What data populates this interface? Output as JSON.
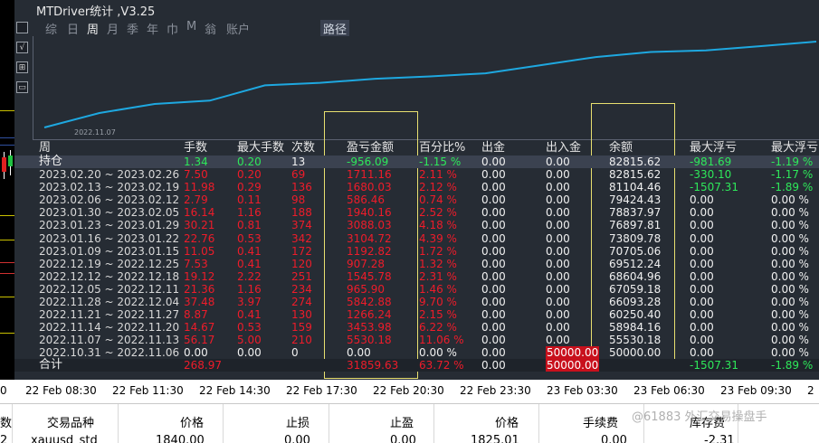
{
  "window": {
    "title": "MTDriver统计 ,V3.25",
    "tabs": [
      "综",
      "日",
      "周",
      "月",
      "季",
      "年",
      "巾",
      "M",
      "翁",
      "账户"
    ],
    "active_tab": "周",
    "path_button": "路径",
    "side_icons": [
      "square-icon",
      "chart-icon",
      "zoom-icon",
      "window-icon"
    ]
  },
  "curve": {
    "start_date": "2022.11.07",
    "line_color": "#1ea8e0",
    "balance_points": [
      50000.0,
      55530.18,
      58984.16,
      60250.4,
      66093.28,
      67059.18,
      68604.96,
      69512.24,
      70705.06,
      73809.78,
      76897.81,
      78837.97,
      79424.43,
      81104.46,
      82815.62
    ]
  },
  "table": {
    "headers": [
      "周",
      "手数",
      "最大手数",
      "次数",
      "盈亏金额",
      "百分比%",
      "出金",
      "出入金",
      "余额",
      "最大浮亏",
      "最大浮亏"
    ],
    "holding": {
      "label": "持仓",
      "lots": "1.34",
      "max_lots": "0.20",
      "count": "13",
      "pnl": "-956.09",
      "pct": "-1.15 %",
      "withdraw": "0.00",
      "inout": "0.00",
      "balance": "82815.62",
      "max_dd": "-981.69",
      "max_dd_pct": "-1.19 %"
    },
    "rows": [
      {
        "week": "2023.02.20 ~ 2023.02.26",
        "lots": "7.50",
        "max_lots": "0.20",
        "count": "69",
        "pnl": "1711.16",
        "pct": "2.11 %",
        "withdraw": "0.00",
        "inout": "0.00",
        "balance": "82815.62",
        "max_dd": "-330.10",
        "max_dd_pct": "-1.17 %"
      },
      {
        "week": "2023.02.13 ~ 2023.02.19",
        "lots": "11.98",
        "max_lots": "0.29",
        "count": "136",
        "pnl": "1680.03",
        "pct": "2.12 %",
        "withdraw": "0.00",
        "inout": "0.00",
        "balance": "81104.46",
        "max_dd": "-1507.31",
        "max_dd_pct": "-1.89 %"
      },
      {
        "week": "2023.02.06 ~ 2023.02.12",
        "lots": "2.79",
        "max_lots": "0.11",
        "count": "98",
        "pnl": "586.46",
        "pct": "0.74 %",
        "withdraw": "0.00",
        "inout": "0.00",
        "balance": "79424.43",
        "max_dd": "0.00",
        "max_dd_pct": "0.00 %"
      },
      {
        "week": "2023.01.30 ~ 2023.02.05",
        "lots": "16.14",
        "max_lots": "1.16",
        "count": "188",
        "pnl": "1940.16",
        "pct": "2.52 %",
        "withdraw": "0.00",
        "inout": "0.00",
        "balance": "78837.97",
        "max_dd": "0.00",
        "max_dd_pct": "0.00 %"
      },
      {
        "week": "2023.01.23 ~ 2023.01.29",
        "lots": "30.21",
        "max_lots": "0.81",
        "count": "374",
        "pnl": "3088.03",
        "pct": "4.18 %",
        "withdraw": "0.00",
        "inout": "0.00",
        "balance": "76897.81",
        "max_dd": "0.00",
        "max_dd_pct": "0.00 %"
      },
      {
        "week": "2023.01.16 ~ 2023.01.22",
        "lots": "22.76",
        "max_lots": "0.53",
        "count": "342",
        "pnl": "3104.72",
        "pct": "4.39 %",
        "withdraw": "0.00",
        "inout": "0.00",
        "balance": "73809.78",
        "max_dd": "0.00",
        "max_dd_pct": "0.00 %"
      },
      {
        "week": "2023.01.09 ~ 2023.01.15",
        "lots": "11.05",
        "max_lots": "0.41",
        "count": "172",
        "pnl": "1192.82",
        "pct": "1.72 %",
        "withdraw": "0.00",
        "inout": "0.00",
        "balance": "70705.06",
        "max_dd": "0.00",
        "max_dd_pct": "0.00 %"
      },
      {
        "week": "2022.12.19 ~ 2022.12.25",
        "lots": "7.53",
        "max_lots": "0.41",
        "count": "120",
        "pnl": "907.28",
        "pct": "1.32 %",
        "withdraw": "0.00",
        "inout": "0.00",
        "balance": "69512.24",
        "max_dd": "0.00",
        "max_dd_pct": "0.00 %"
      },
      {
        "week": "2022.12.12 ~ 2022.12.18",
        "lots": "19.12",
        "max_lots": "2.22",
        "count": "251",
        "pnl": "1545.78",
        "pct": "2.31 %",
        "withdraw": "0.00",
        "inout": "0.00",
        "balance": "68604.96",
        "max_dd": "0.00",
        "max_dd_pct": "0.00 %"
      },
      {
        "week": "2022.12.05 ~ 2022.12.11",
        "lots": "21.36",
        "max_lots": "1.16",
        "count": "234",
        "pnl": "965.90",
        "pct": "1.46 %",
        "withdraw": "0.00",
        "inout": "0.00",
        "balance": "67059.18",
        "max_dd": "0.00",
        "max_dd_pct": "0.00 %"
      },
      {
        "week": "2022.11.28 ~ 2022.12.04",
        "lots": "37.48",
        "max_lots": "3.97",
        "count": "274",
        "pnl": "5842.88",
        "pct": "9.70 %",
        "withdraw": "0.00",
        "inout": "0.00",
        "balance": "66093.28",
        "max_dd": "0.00",
        "max_dd_pct": "0.00 %"
      },
      {
        "week": "2022.11.21 ~ 2022.11.27",
        "lots": "8.87",
        "max_lots": "0.41",
        "count": "130",
        "pnl": "1266.24",
        "pct": "2.15 %",
        "withdraw": "0.00",
        "inout": "0.00",
        "balance": "60250.40",
        "max_dd": "0.00",
        "max_dd_pct": "0.00 %"
      },
      {
        "week": "2022.11.14 ~ 2022.11.20",
        "lots": "14.67",
        "max_lots": "0.53",
        "count": "159",
        "pnl": "3453.98",
        "pct": "6.22 %",
        "withdraw": "0.00",
        "inout": "0.00",
        "balance": "58984.16",
        "max_dd": "0.00",
        "max_dd_pct": "0.00 %"
      },
      {
        "week": "2022.11.07 ~ 2022.11.13",
        "lots": "56.17",
        "max_lots": "5.00",
        "count": "210",
        "pnl": "5530.18",
        "pct": "11.06 %",
        "withdraw": "0.00",
        "inout": "0.00",
        "balance": "55530.18",
        "max_dd": "0.00",
        "max_dd_pct": "0.00 %"
      },
      {
        "week": "2022.10.31 ~ 2022.11.06",
        "lots": "0.00",
        "max_lots": "0.00",
        "count": "0",
        "pnl": "0.00",
        "pct": "0.00 %",
        "withdraw": "0.00",
        "inout": "50000.00",
        "balance": "50000.00",
        "max_dd": "0.00",
        "max_dd_pct": "0.00 %"
      }
    ],
    "total": {
      "label": "合计",
      "lots": "268.97",
      "pnl": "31859.63",
      "pct": "63.72 %",
      "withdraw": "0.00",
      "inout": "50000.00",
      "max_dd": "-1507.31",
      "max_dd_pct": "-1.89 %"
    }
  },
  "time_axis": {
    "labels": [
      "0",
      "22 Feb 08:30",
      "22 Feb 11:30",
      "22 Feb 14:30",
      "22 Feb 17:30",
      "22 Feb 20:30",
      "22 Feb 23:30",
      "23 Feb 03:30",
      "23 Feb 06:30",
      "23 Feb 09:30",
      "2"
    ]
  },
  "orders": {
    "headers": [
      "数",
      "交易品种",
      "价格",
      "止损",
      "止盈",
      "价格",
      "手续费",
      "库存费"
    ],
    "values": [
      "2",
      "xauusd_std",
      "1840.00",
      "0.00",
      "0.00",
      "1825.01",
      "0.00",
      "-2.31"
    ],
    "watermark": "@61883 外汇交易操盘手"
  },
  "colors": {
    "window_bg": "#262c34",
    "profit_red": "#ee1c2a",
    "loss_green": "#2ee85a",
    "highlight": "#e8e070"
  }
}
